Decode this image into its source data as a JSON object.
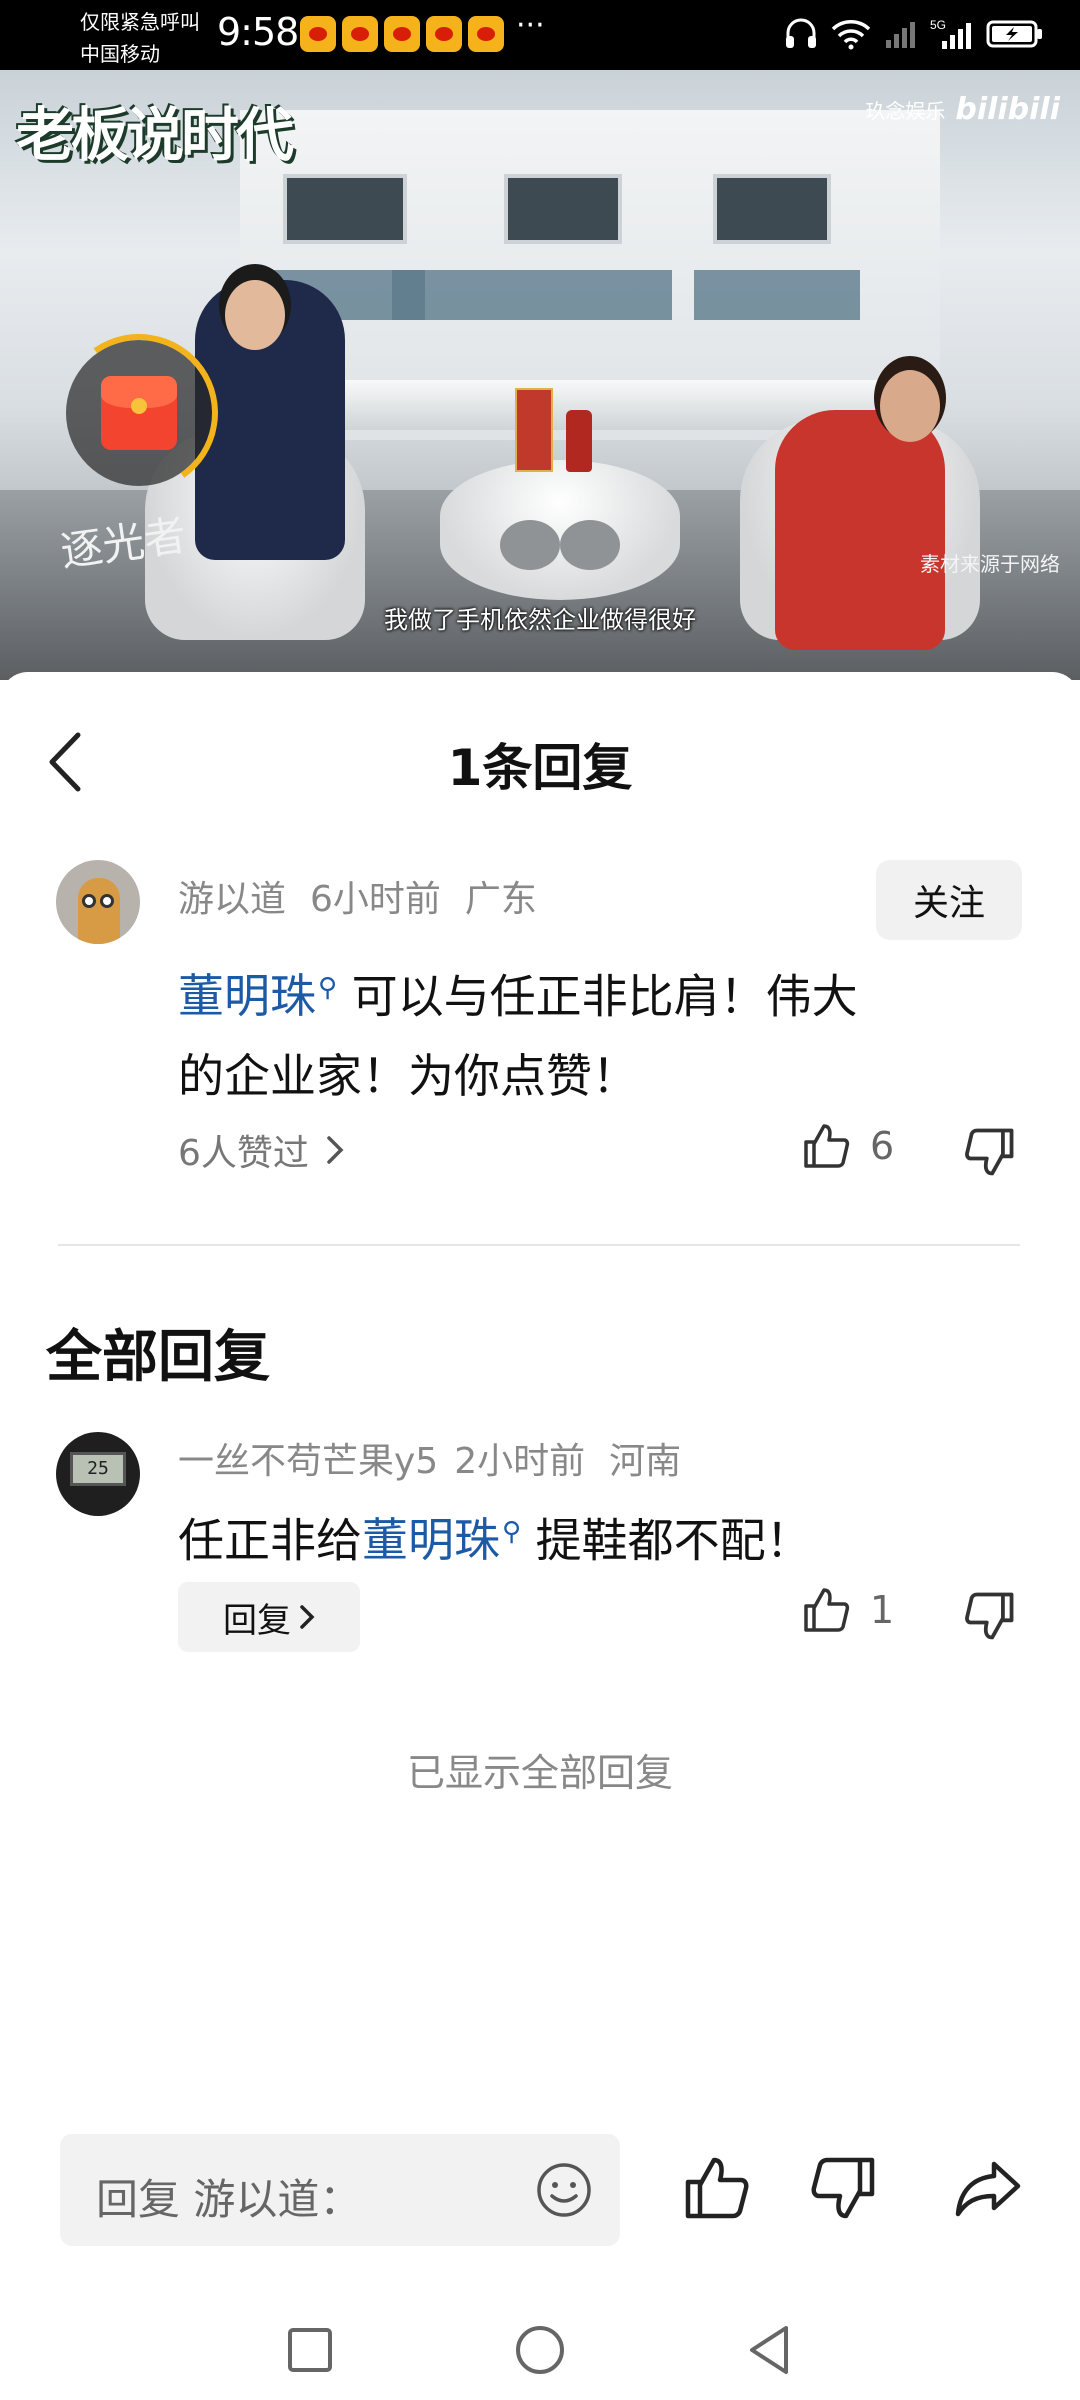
{
  "status_bar": {
    "carrier_line1": "仅限紧急呼叫",
    "carrier_line2": "中国移动",
    "time": "9:58",
    "notification_icons": [
      "weibo-icon",
      "weibo-icon",
      "weibo-icon",
      "weibo-icon",
      "weibo-icon"
    ],
    "more": "···",
    "right_icons": [
      "headphones-icon",
      "wifi-icon",
      "signal-icon",
      "signal-5g-icon",
      "battery-charging-icon"
    ]
  },
  "video": {
    "logo_text": "老板说时代",
    "brand_label": "玖念娱乐",
    "platform_logo": "bilibili",
    "source_note": "素材来源于网络",
    "subtitle": "我做了手机依然企业做得很好",
    "calligraphy": "逐光者",
    "red_packet_icon": "red-envelope-icon"
  },
  "sheet": {
    "title": "1条回复",
    "back_icon": "back-arrow-icon"
  },
  "main_comment": {
    "username": "游以道",
    "time": "6小时前",
    "location": "广东",
    "follow_label": "关注",
    "mention": "董明珠",
    "text_line1": " 可以与任正非比肩！伟大",
    "text_line2": "的企业家！为你点赞！",
    "liked_by": "6人赞过",
    "like_count": "6"
  },
  "section_title": "全部回复",
  "replies": [
    {
      "username": "一丝不苟芒果y5",
      "time": "2小时前",
      "location": "河南",
      "text_before": "任正非给",
      "mention": "董明珠",
      "text_after": " 提鞋都不配！",
      "reply_label": "回复",
      "like_count": "1",
      "avatar_display": "25"
    }
  ],
  "footer_note": "已显示全部回复",
  "bottom_bar": {
    "placeholder": "回复 游以道：",
    "icons": [
      "emoji-icon",
      "thumbs-up-icon",
      "thumbs-down-icon",
      "share-icon"
    ]
  },
  "nav_bar": {
    "icons": [
      "recent-apps-icon",
      "home-icon",
      "back-icon"
    ]
  },
  "colors": {
    "mention": "#1c5aa6",
    "meta_text": "#888888",
    "red_packet": "#f2442e",
    "ring": "#f2b31b"
  }
}
